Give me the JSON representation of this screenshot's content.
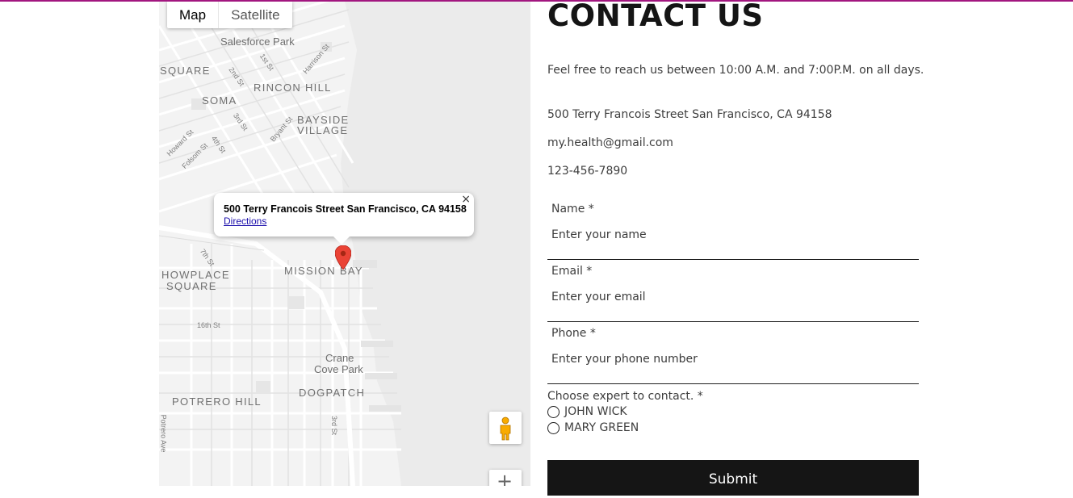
{
  "map": {
    "tabs": [
      "Map",
      "Satellite"
    ],
    "labels": {
      "salesforce_park": "Salesforce Park",
      "square": "SQUARE",
      "rincon_hill": "RINCON HILL",
      "soma": "SOMA",
      "bayside": "BAYSIDE",
      "village": "VILLAGE",
      "howplace": "HOWPLACE",
      "square2": "SQUARE",
      "mission_bay": "MISSION BAY",
      "crane": "Crane",
      "cove_park": "Cove Park",
      "potrero_hill": "POTRERO HILL",
      "dogpatch": "DOGPATCH",
      "first_st": "1st St",
      "harrison_st": "Harrison St",
      "second_st": "2nd St",
      "third_st_a": "3rd St",
      "howard_st": "Howard St",
      "folsom_st": "Folsom St",
      "fourth_st": "4th St",
      "bryant_st": "Bryant St",
      "seventh_st": "7th St",
      "sixteenth_st": "16th St",
      "third_st_b": "3rd St",
      "potrero_ave": "Potrero Ave"
    },
    "infowindow": {
      "address": "500 Terry Francois Street San Francisco, CA 94158",
      "directions": "Directions",
      "close": "×"
    },
    "zoom_in": "+"
  },
  "contact": {
    "title": "CONTACT US",
    "hours": "Feel free to reach us between 10:00 A.M. and 7:00P.M. on all days.",
    "address": "500 Terry Francois Street San Francisco, CA 94158",
    "email": "my.health@gmail.com",
    "phone": "123-456-7890",
    "fields": {
      "name": {
        "label": "Name *",
        "placeholder": "Enter your name"
      },
      "email": {
        "label": "Email *",
        "placeholder": "Enter your email"
      },
      "phone": {
        "label": "Phone *",
        "placeholder": "Enter your phone number"
      }
    },
    "expert_label": "Choose expert to contact. *",
    "experts": [
      "JOHN WICK",
      "MARY GREEN"
    ],
    "submit": "Submit"
  },
  "colors": {
    "accent": "#a2167f",
    "button_bg": "#151515",
    "pin": "#ea4335"
  }
}
